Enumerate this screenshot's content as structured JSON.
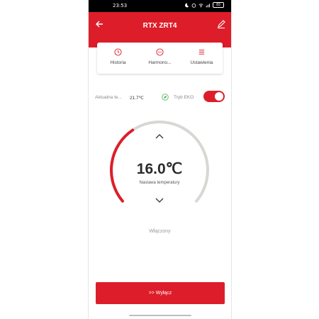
{
  "status_bar": {
    "time": "23:53",
    "battery": "83"
  },
  "header": {
    "title": "RTX ZRT4"
  },
  "tabs": [
    {
      "label": "Historia",
      "icon": "clock-icon"
    },
    {
      "label": "Harmono...",
      "icon": "more-dots-icon"
    },
    {
      "label": "Ustawienia",
      "icon": "menu-lines-icon"
    }
  ],
  "current_temp": {
    "label": "Aktualna te...",
    "value": "21.7℃"
  },
  "eko": {
    "label": "Tryb EKO",
    "enabled": true,
    "icon": "leaf-icon"
  },
  "setpoint": {
    "value": "16.0℃",
    "label": "Nastawa temperatury",
    "fill_fraction": 0.37
  },
  "device_status": "Włączony",
  "power_button": {
    "label": ">> Wyłącz"
  },
  "colors": {
    "accent": "#dd1e2a",
    "track": "#d7d7d3"
  }
}
